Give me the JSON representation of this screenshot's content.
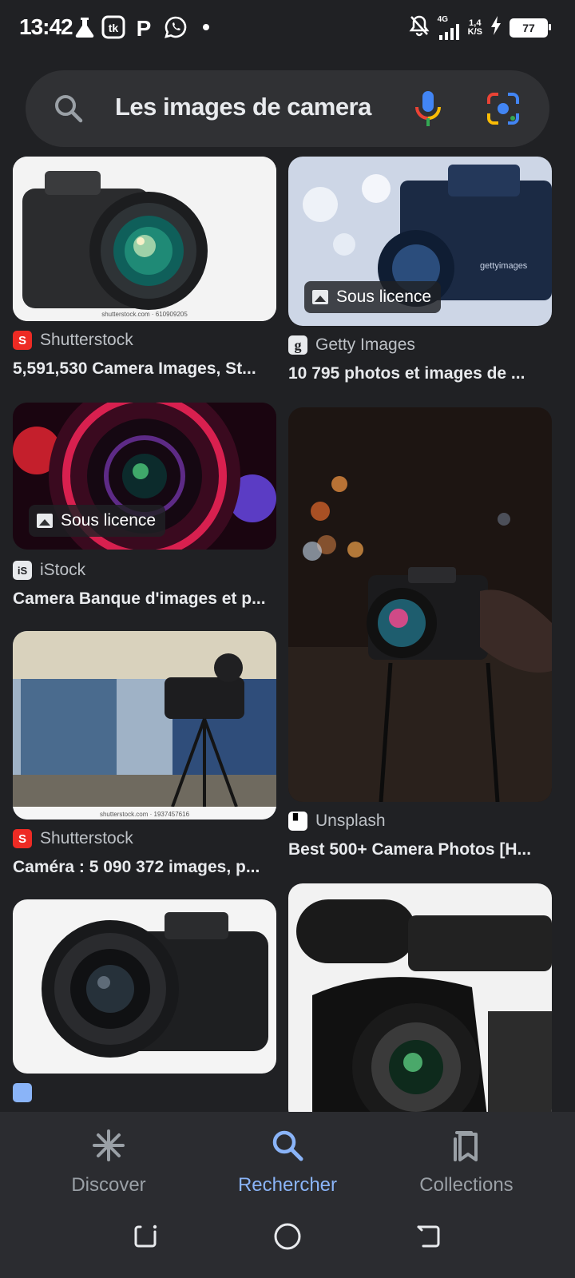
{
  "status_bar": {
    "time": "13:42",
    "network": "4G",
    "speed_value": "1,4",
    "speed_unit": "K/S",
    "battery": "77"
  },
  "search": {
    "query": "Les images de camera"
  },
  "results": [
    {
      "source": "Shutterstock",
      "title": "5,591,530 Camera Images, St...",
      "watermark": "shutterstock.com · 610909205",
      "badge": ""
    },
    {
      "source": "Getty Images",
      "title": "10 795 photos et images de ...",
      "watermark": "gettyimages",
      "badge": "Sous licence"
    },
    {
      "source": "iStock",
      "title": "Camera Banque d'images et p...",
      "badge": "Sous licence"
    },
    {
      "source": "Unsplash",
      "title": "Best 500+ Camera Photos [H..."
    },
    {
      "source": "Shutterstock",
      "title": "Caméra : 5 090 372 images, p...",
      "watermark": "shutterstock.com · 1937457616"
    },
    {
      "source": "",
      "title": ""
    },
    {
      "source": "",
      "title": ""
    }
  ],
  "favicons": {
    "shutterstock": "S",
    "getty": "g",
    "istock": "iS",
    "unsplash": "▘"
  },
  "bottom_nav": {
    "discover": "Discover",
    "search": "Rechercher",
    "collections": "Collections"
  },
  "colors": {
    "background": "#202124",
    "search_bar": "#303134",
    "active": "#8ab4f8",
    "shutterstock": "#ee2b24"
  }
}
